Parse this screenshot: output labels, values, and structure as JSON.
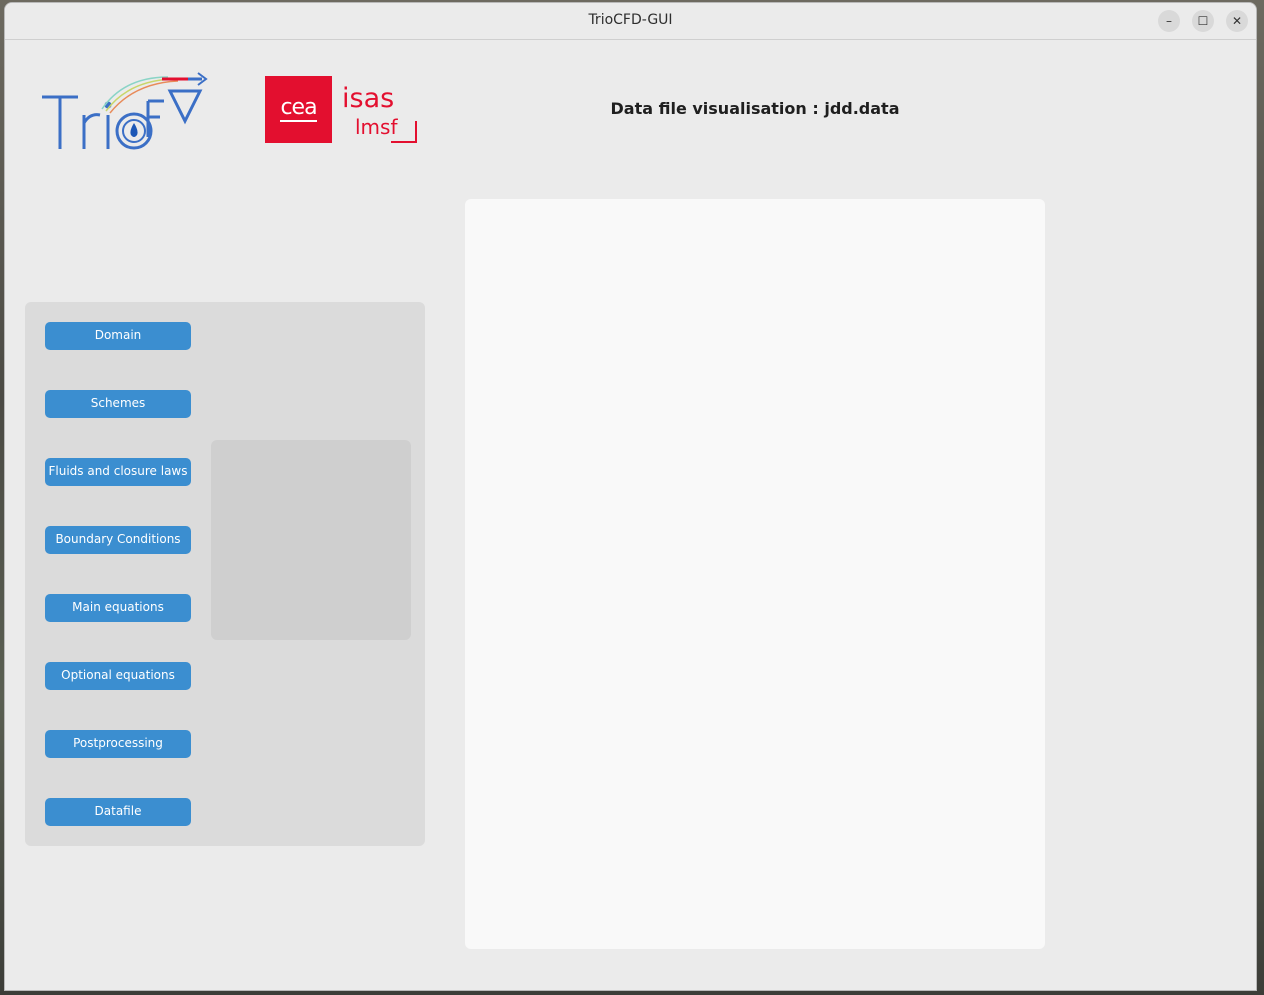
{
  "window": {
    "title": "TrioCFD-GUI",
    "controls": {
      "minimize": "–",
      "maximize": "☐",
      "close": "✕"
    }
  },
  "header": {
    "title": "Data file visualisation : jdd.data",
    "logos": {
      "cea_text": "cea",
      "isas_text": "isas",
      "lmsf_text": "lmsf"
    }
  },
  "sidebar": {
    "buttons": [
      {
        "label": "Domain"
      },
      {
        "label": "Schemes"
      },
      {
        "label": "Fluids and closure laws"
      },
      {
        "label": "Boundary Conditions"
      },
      {
        "label": "Main equations"
      },
      {
        "label": "Optional equations"
      },
      {
        "label": "Postprocessing"
      },
      {
        "label": "Datafile"
      }
    ]
  },
  "colors": {
    "button": "#3b8ed0",
    "brand_red": "#e30f2f",
    "trio_blue": "#3b6fc6",
    "window_bg": "#ebebeb",
    "panel_bg": "#dbdbdb",
    "viewer_bg": "#f9f9f9"
  }
}
